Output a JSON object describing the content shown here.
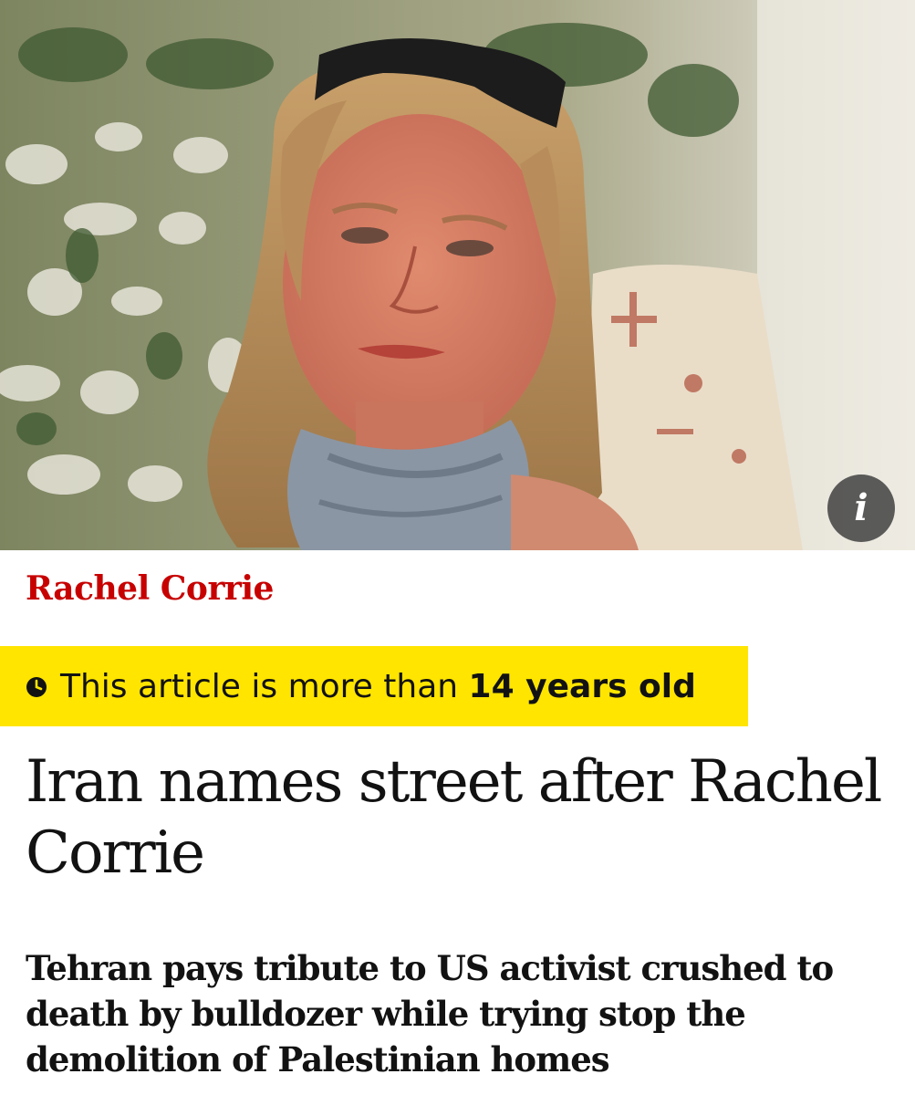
{
  "hero": {
    "info_glyph": "i",
    "info_icon": "info-icon"
  },
  "article": {
    "section_label": "Rachel Corrie",
    "age_notice": {
      "prefix": "This article is more than ",
      "emphasis": "14 years old",
      "icon": "clock-icon"
    },
    "headline": "Iran names street after Rachel Corrie",
    "standfirst": "Tehran pays tribute to US activist crushed to death by bulldozer while trying stop the demolition of Palestinian homes"
  },
  "colors": {
    "section_red": "#c70000",
    "warning_yellow": "#ffe500",
    "text_dark": "#121212"
  }
}
